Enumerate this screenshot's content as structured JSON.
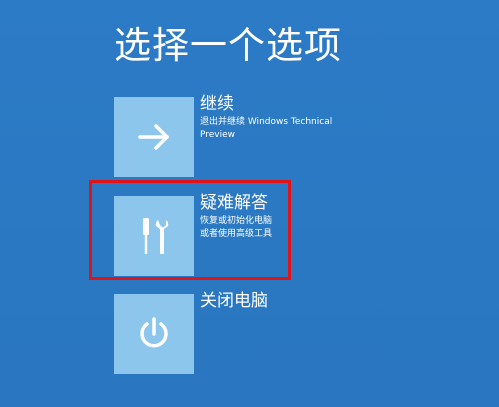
{
  "page": {
    "title": "选择一个选项"
  },
  "options": [
    {
      "label": "继续",
      "description_line1": "退出并继续 Windows Technical",
      "description_line2": "Preview",
      "icon": "arrow-right-icon"
    },
    {
      "label": "疑难解答",
      "description_line1": "恢复或初始化电脑",
      "description_line2": "或者使用高级工具",
      "icon": "tools-icon"
    },
    {
      "label": "关闭电脑",
      "description_line1": "",
      "description_line2": "",
      "icon": "power-icon"
    }
  ],
  "colors": {
    "background": "#2b78c2",
    "tile": "#8cc6ec",
    "highlight": "#e0121a"
  }
}
